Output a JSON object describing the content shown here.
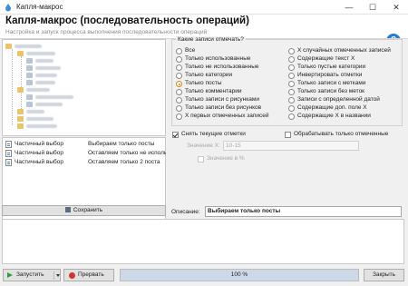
{
  "window": {
    "title": "Капля-макрос",
    "min_glyph": "—",
    "max_glyph": "☐",
    "close_glyph": "✕"
  },
  "header": {
    "title": "Капля-макрос (последовательность операций)",
    "subtitle": "Настройка и запуск процесса выполнения последовательности операций",
    "help_glyph": "?"
  },
  "operations": [
    {
      "type": "Частичный выбор",
      "desc": "Выбираем только посты"
    },
    {
      "type": "Частичный выбор",
      "desc": "Оставляем только не использ"
    },
    {
      "type": "Частичный выбор",
      "desc": "Оставляем только 2 поста"
    }
  ],
  "save_button": "Сохранить",
  "records_group": {
    "legend": "Какие записи отмечать?",
    "left_options": [
      "Все",
      "Только использованные",
      "Только не использованные",
      "Только категории",
      "Только посты",
      "Только комментарии",
      "Только записи с рисунками",
      "Только записи без рисунков",
      "X первых отмеченных записей"
    ],
    "right_options": [
      "X случайных отмеченных записей",
      "Содержащие текст X",
      "Только пустые категории",
      "Инвертировать отметки",
      "Только записи с метками",
      "Только записи без меток",
      "Записи с определенной датой",
      "Содержащие доп. поле X",
      "Содержащие X в названии"
    ],
    "selected": "Только посты"
  },
  "clear_marks": {
    "label": "Снять текущие отметки",
    "checked": true
  },
  "process_marked": {
    "label": "Обрабатывать только отмеченные",
    "checked": false
  },
  "value_x": {
    "label": "Значение X:",
    "value": "10-15"
  },
  "value_percent": {
    "label": "Значение в %",
    "checked": false
  },
  "description": {
    "label": "Описание:",
    "value": "Выбираем только посты"
  },
  "run_button": "Запустить",
  "stop_button": "Прервать",
  "progress": {
    "percent": 100,
    "text": "100 %"
  },
  "close_button": "Закрыть",
  "colors": {
    "accent_orange": "#d68a1a",
    "run_green": "#2e9e3a",
    "stop_red": "#d0352b",
    "help_blue": "#2a7ad2"
  }
}
